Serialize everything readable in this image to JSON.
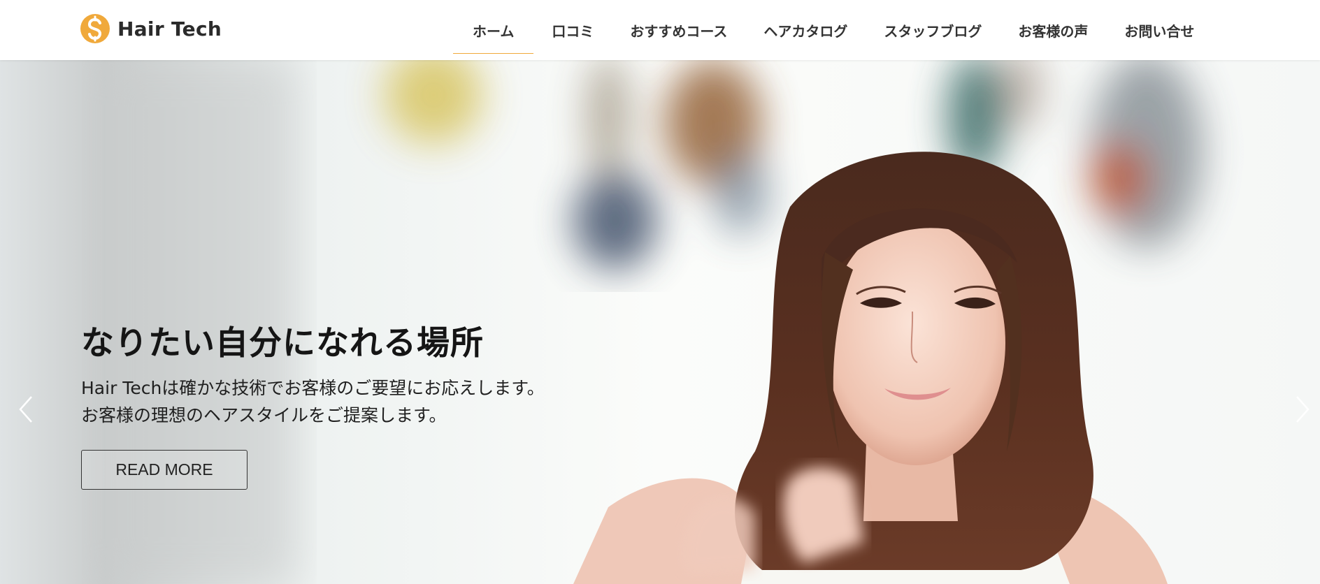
{
  "brand": {
    "name": "Hair Tech",
    "logo_icon": "dollar-s-icon",
    "accent_color": "#f0a93b"
  },
  "nav": {
    "items": [
      {
        "label": "ホーム",
        "active": true
      },
      {
        "label": "口コミ",
        "active": false
      },
      {
        "label": "おすすめコース",
        "active": false
      },
      {
        "label": "ヘアカタログ",
        "active": false
      },
      {
        "label": "スタッフブログ",
        "active": false
      },
      {
        "label": "お客様の声",
        "active": false
      },
      {
        "label": "お問い合せ",
        "active": false
      }
    ]
  },
  "hero": {
    "title": "なりたい自分になれる場所",
    "lines": [
      "Hair Techは確かな技術でお客様のご要望にお応えします。",
      "お客様の理想のヘアスタイルをご提案します。"
    ],
    "button_label": "READ MORE",
    "prev_icon": "chevron-left-icon",
    "next_icon": "chevron-right-icon"
  }
}
